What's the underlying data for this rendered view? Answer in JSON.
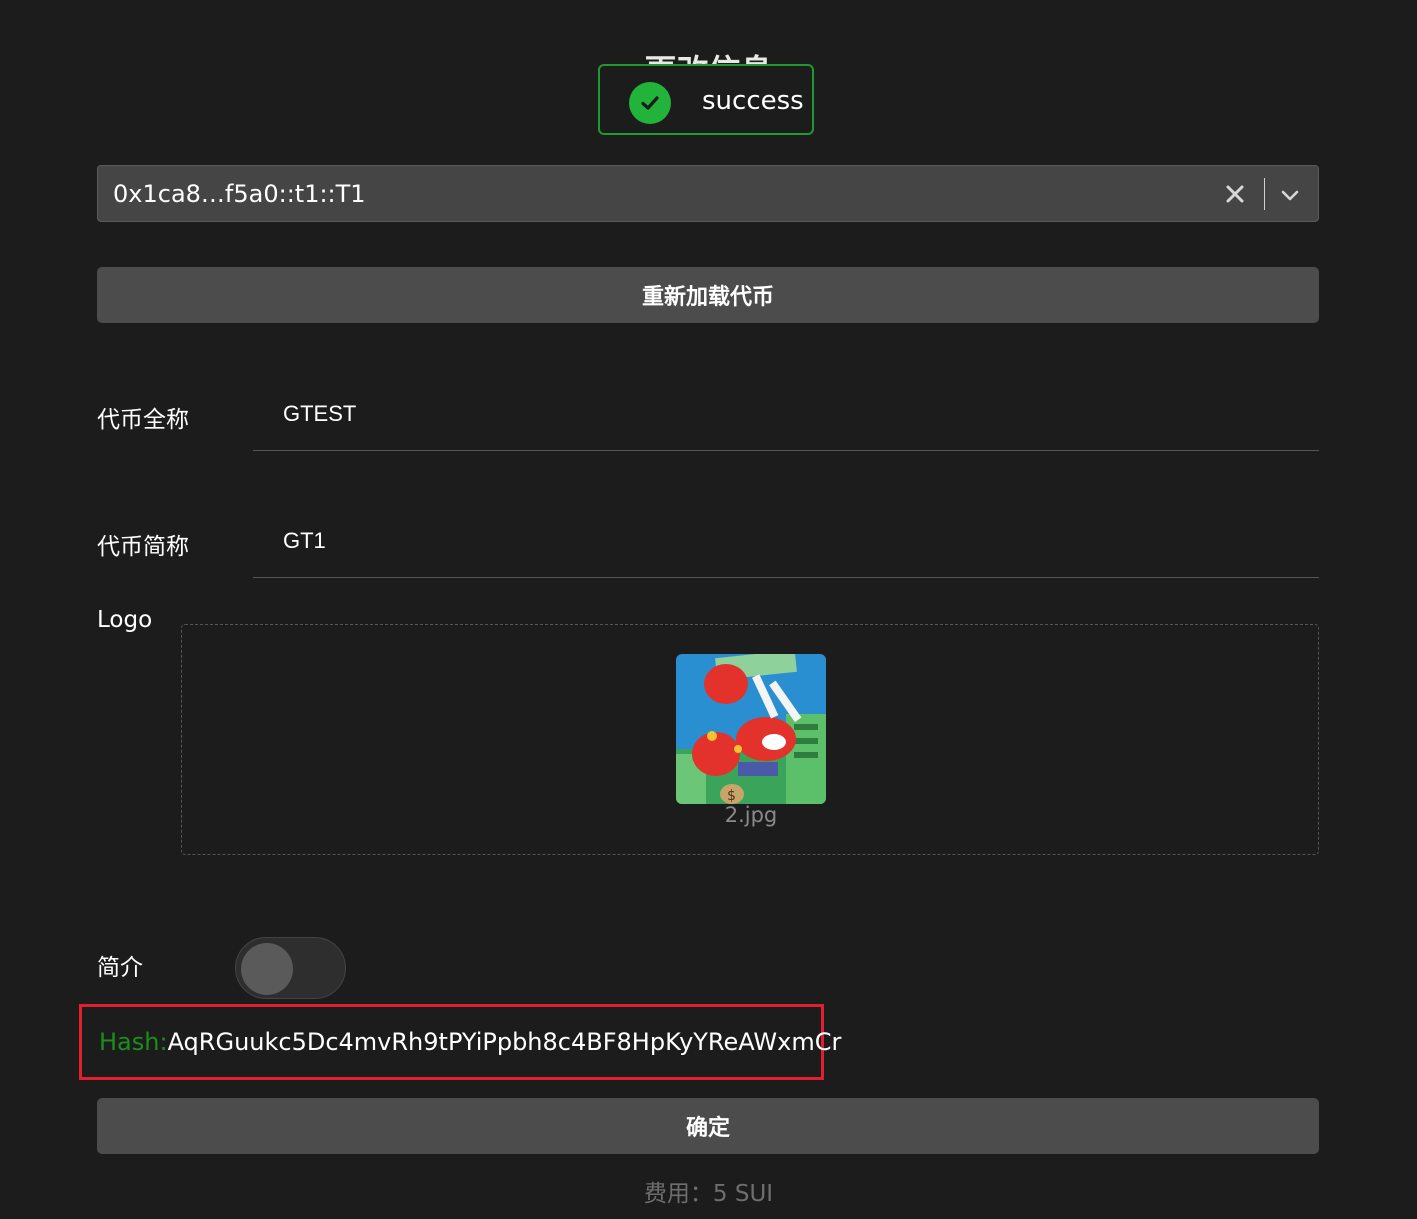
{
  "page": {
    "title": "更改信息"
  },
  "toast": {
    "icon": "check-circle-icon",
    "text": "success",
    "color": "#22b33a"
  },
  "coin_select": {
    "value": "0x1ca8…f5a0::t1::T1",
    "clear_icon": "close-icon",
    "dropdown_icon": "chevron-down-icon"
  },
  "reload_button": {
    "label": "重新加载代币"
  },
  "fields": {
    "full_name": {
      "label": "代币全称",
      "value": "GTEST"
    },
    "short_name": {
      "label": "代币简称",
      "value": "GT1"
    },
    "logo": {
      "label": "Logo",
      "file_name": "2.jpg"
    },
    "intro": {
      "label": "简介",
      "toggle_on": false
    }
  },
  "hash": {
    "prefix": "Hash:",
    "value": "AqRGuukc5Dc4mvRh9tPYiPpbh8c4BF8HpKyYReAWxmCr",
    "highlight_color": "#e0202e"
  },
  "confirm_button": {
    "label": "确定"
  },
  "fee": {
    "text": "费用：5 SUI"
  }
}
